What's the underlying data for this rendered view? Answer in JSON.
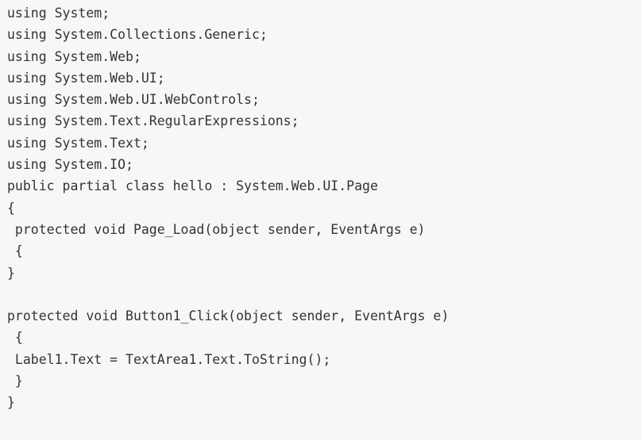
{
  "code": {
    "lines": [
      "using System;",
      "using System.Collections.Generic;",
      "using System.Web;",
      "using System.Web.UI;",
      "using System.Web.UI.WebControls;",
      "using System.Text.RegularExpressions;",
      "using System.Text;",
      "using System.IO;",
      "public partial class hello : System.Web.UI.Page",
      "{",
      " protected void Page_Load(object sender, EventArgs e)",
      " {",
      "}",
      "",
      "protected void Button1_Click(object sender, EventArgs e)",
      " {",
      " Label1.Text = TextArea1.Text.ToString();",
      " }",
      "}"
    ]
  },
  "colors": {
    "background": "#f7f7f7",
    "text": "#333333"
  }
}
